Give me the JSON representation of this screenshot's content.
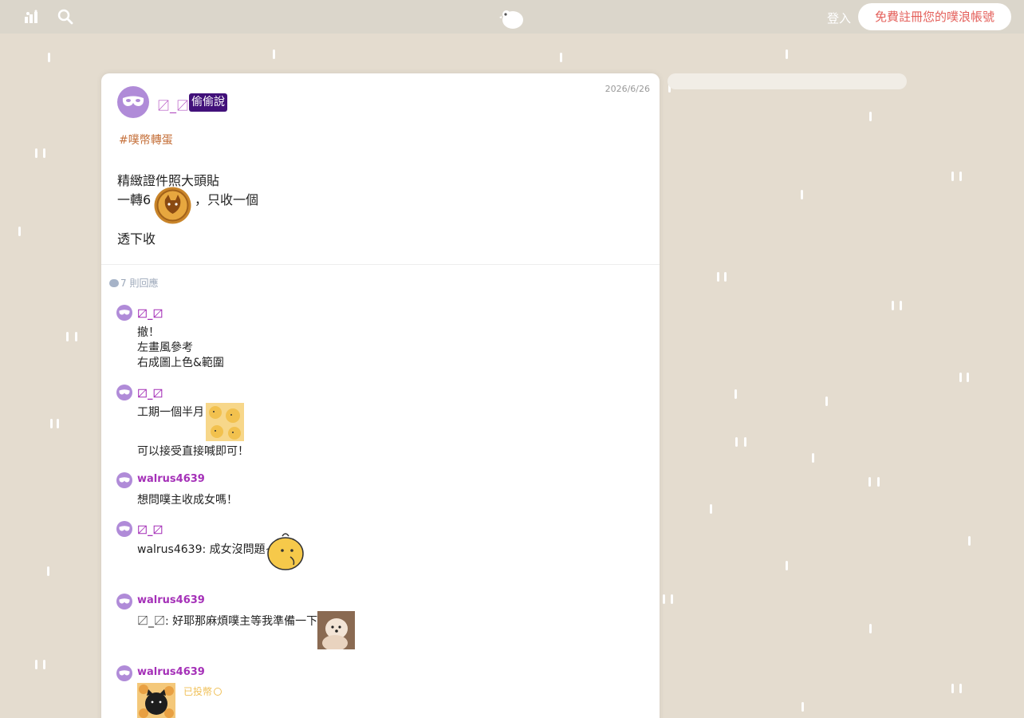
{
  "topbar": {
    "hot_icon": "hot-icon",
    "search_icon": "search-icon",
    "logo_icon": "plurk-logo-icon",
    "login_label": "登入",
    "signup_label": "免費註冊您的噗浪帳號"
  },
  "post": {
    "author": "〼_〼",
    "whisper_badge": "偷偷說",
    "date": "2026/6/26",
    "hashtag": "#噗幣轉蛋",
    "lines": [
      "精緻證件照大頭貼",
      "一轉6",
      "，只收一個",
      "透下收"
    ],
    "coin_icon": "plurk-coin-icon"
  },
  "replies": {
    "count_label": "7 則回應",
    "items": [
      {
        "name": "〼_〼",
        "lines": [
          "撤！",
          "左畫風參考",
          "右成圖上色&範圍"
        ]
      },
      {
        "name": "〼_〼",
        "lines": [
          "工期一個半月",
          "可以接受直接喊即可！"
        ],
        "image": "duck-sticker-pattern"
      },
      {
        "name": "walrus4639",
        "lines": [
          "想問噗主收成女嗎！"
        ]
      },
      {
        "name": "〼_〼",
        "lines": [
          "walrus4639: 成女沒問題~"
        ],
        "image": "chick-sticker"
      },
      {
        "name": "walrus4639",
        "lines": [
          "〼_〼: 好耶那麻煩噗主等我準備一下"
        ],
        "image": "puppy-photo"
      },
      {
        "name": "walrus4639",
        "paid_note": "已投幣",
        "image": "cat-sticker-pattern"
      }
    ]
  },
  "colors": {
    "background": "#e4dccf",
    "topbar": "#dbd6cb",
    "author_purple": "#b24fc0",
    "badge_bg": "#42117a",
    "signup_text": "#e4605b",
    "hashtag": "#c5703a"
  }
}
